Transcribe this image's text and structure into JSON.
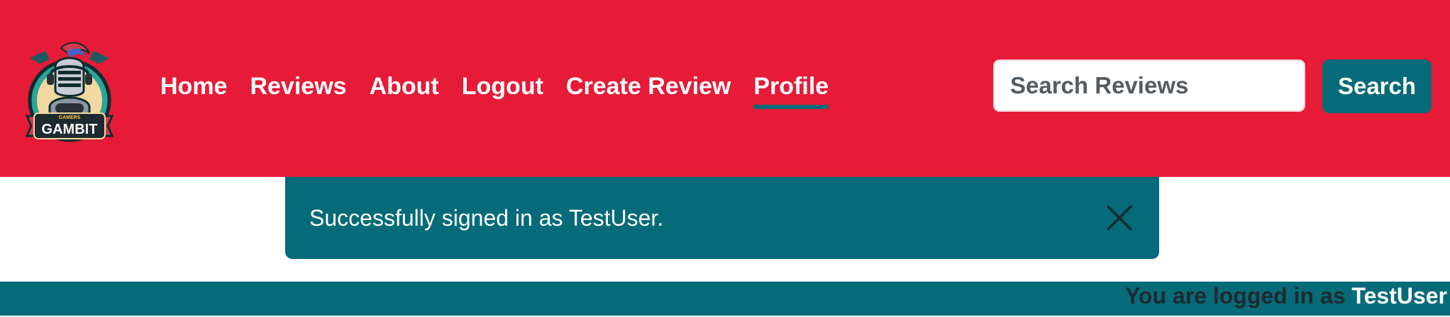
{
  "brand": {
    "logo_text": "GAMBIT",
    "logo_subtext": "GAMERS",
    "logo_icon": "knight-with-controller-logo"
  },
  "nav": {
    "items": [
      {
        "label": "Home"
      },
      {
        "label": "Reviews"
      },
      {
        "label": "About"
      },
      {
        "label": "Logout"
      },
      {
        "label": "Create Review"
      },
      {
        "label": "Profile",
        "active": true
      }
    ]
  },
  "search": {
    "placeholder": "Search Reviews",
    "button_label": "Search"
  },
  "alert": {
    "message": "Successfully signed in as TestUser.",
    "close_icon": "close-icon"
  },
  "status": {
    "prefix": "You are logged in as",
    "username": "TestUser"
  },
  "colors": {
    "header_bg": "#e51b37",
    "accent_teal": "#066b78",
    "white": "#ffffff",
    "status_text_dark": "#1e2a30"
  }
}
